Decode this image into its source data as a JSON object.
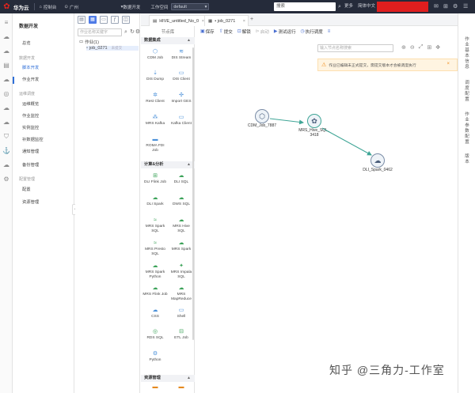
{
  "topbar": {
    "brand": "华为云",
    "console": "控制台",
    "region": "广州",
    "module": "数据开发",
    "workspace_label": "工作空间",
    "workspace_value": "default",
    "search": "搜索",
    "more": "更多",
    "language": "简体中文"
  },
  "module_menu": {
    "title": "数据开发",
    "items": [
      {
        "label": "总览",
        "group": false
      },
      {
        "label": "数据开发",
        "group": true
      },
      {
        "label": "脚本开发",
        "group": false
      },
      {
        "label": "作业开发",
        "group": false
      },
      {
        "label": "运维调度",
        "group": true
      },
      {
        "label": "运维概览",
        "group": false
      },
      {
        "label": "作业监控",
        "group": false
      },
      {
        "label": "实例监控",
        "group": false
      },
      {
        "label": "补数据监控",
        "group": false
      },
      {
        "label": "通知管理",
        "group": false
      },
      {
        "label": "备份管理",
        "group": false
      },
      {
        "label": "配置管理",
        "group": true
      },
      {
        "label": "配置",
        "group": false
      },
      {
        "label": "资源管理",
        "group": false
      }
    ]
  },
  "tree": {
    "search_placeholder": "作业名称关键字",
    "root": "作业(1)",
    "job": "job_0271",
    "job_hint": "未提交"
  },
  "tabs": [
    {
      "label": "HIVE_untitled_No_0"
    },
    {
      "label": "• job_0271"
    }
  ],
  "toolbar": [
    {
      "label": "保存",
      "icon": "save-icon",
      "disabled": false
    },
    {
      "label": "提交",
      "icon": "submit-icon",
      "disabled": false
    },
    {
      "label": "解锁",
      "icon": "unlock-icon",
      "disabled": false
    },
    {
      "label": "启动",
      "icon": "start-icon",
      "disabled": true
    },
    {
      "label": "测试运行",
      "icon": "test-run-icon",
      "disabled": false
    },
    {
      "label": "执行调度",
      "icon": "schedule-icon",
      "disabled": false
    }
  ],
  "library": {
    "title": "节点库",
    "categories": [
      {
        "label": "数据集成"
      },
      {
        "label": "计算&分析"
      },
      {
        "label": "资源管理"
      }
    ],
    "integration_nodes": [
      "CDM Job",
      "DIS Stream",
      "DIS Dump",
      "DIS Client",
      "Rest Client",
      "Import GES",
      "MRS Kafka",
      "Kafka Client",
      "ROMA FDI Job"
    ],
    "compute_nodes": [
      "DLI Flink Job",
      "DLI SQL",
      "DLI Spark",
      "DWS SQL",
      "MRS Spark SQL",
      "MRS Hive SQL",
      "MRS Presto SQL",
      "MRS Spark",
      "MRS Spark Python",
      "MRS Impala SQL",
      "MRS Flink Job",
      "MRS MapReduce",
      "CSS",
      "Shell",
      "RDS SQL",
      "ETL Job",
      "Python"
    ]
  },
  "canvas": {
    "search_placeholder": "输入节点名称搜索",
    "warning": "作业已编辑未正式提交，需提交版本才会被调度执行",
    "nodes": [
      {
        "name": "CDM_Job_7887"
      },
      {
        "name": "MRS_Hive_SQL_3418"
      },
      {
        "name": "DLI_Spark_0462"
      }
    ]
  },
  "rail": {
    "tabs": [
      "作业基本信息",
      "调度配置",
      "作业参数配置",
      "版本"
    ]
  },
  "watermark": "知乎 @三角力-工作室"
}
